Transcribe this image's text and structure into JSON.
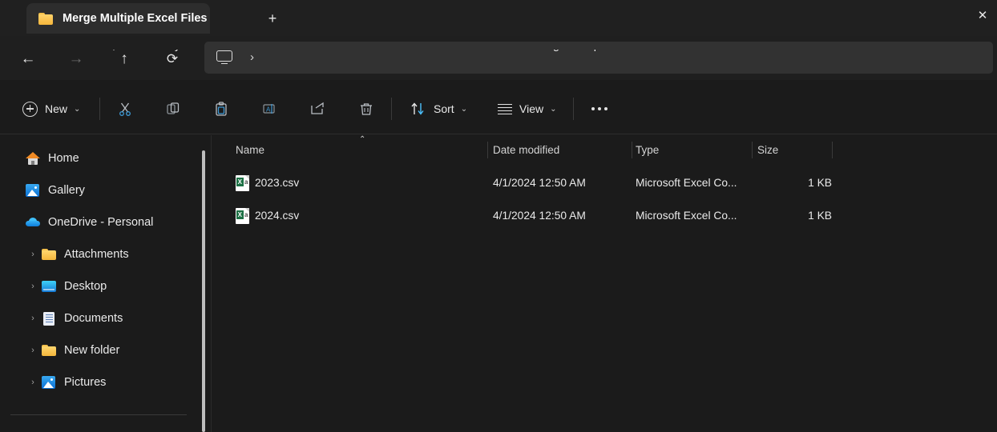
{
  "window": {
    "tab": {
      "title": "Merge Multiple Excel Files",
      "folder_icon": "folder-icon",
      "close_label": "✕"
    },
    "new_tab_label": "+"
  },
  "navigation": {
    "back": "←",
    "forward": "→",
    "up": "↑",
    "refresh": "⟳"
  },
  "address_bar": {
    "monitor_icon": "this-pc-icon",
    "separator": "›",
    "crumb_fragment_1": ",",
    "crumb_fragment_2": "y",
    "crumb_text": "Merge Multiple Excel Files"
  },
  "toolbar": {
    "new_label": "New",
    "cut_label": "Cut",
    "copy_label": "Copy",
    "paste_label": "Paste",
    "rename_label": "Rename",
    "share_label": "Share",
    "delete_label": "Delete",
    "sort_label": "Sort",
    "view_label": "View",
    "more_label": "See more",
    "chevron": "⌄"
  },
  "sidebar": {
    "items": [
      {
        "label": "Home",
        "icon": "home-icon",
        "indent": 0,
        "expander": ""
      },
      {
        "label": "Gallery",
        "icon": "gallery-icon",
        "indent": 0,
        "expander": ""
      },
      {
        "label": "OneDrive - Personal",
        "icon": "onedrive-icon",
        "indent": 0,
        "expander": "⌄"
      },
      {
        "label": "Attachments",
        "icon": "folder-icon",
        "indent": 1,
        "expander": "›"
      },
      {
        "label": "Desktop",
        "icon": "desktop-icon",
        "indent": 1,
        "expander": "›"
      },
      {
        "label": "Documents",
        "icon": "documents-icon",
        "indent": 1,
        "expander": "›"
      },
      {
        "label": "New folder",
        "icon": "folder-icon",
        "indent": 1,
        "expander": "›"
      },
      {
        "label": "Pictures",
        "icon": "pictures-icon",
        "indent": 1,
        "expander": "›"
      }
    ]
  },
  "file_list": {
    "columns": [
      "Name",
      "Date modified",
      "Type",
      "Size"
    ],
    "sort_indicator": "⌃",
    "rows": [
      {
        "name": "2023.csv",
        "date": "4/1/2024 12:50 AM",
        "type": "Microsoft Excel Co...",
        "size": "1 KB",
        "icon": "csv-file-icon"
      },
      {
        "name": "2024.csv",
        "date": "4/1/2024 12:50 AM",
        "type": "Microsoft Excel Co...",
        "size": "1 KB",
        "icon": "csv-file-icon"
      }
    ]
  },
  "colors": {
    "accent_blue": "#4cc2ff",
    "excel_green": "#1d7145",
    "folder_yellow": "#f4b63b",
    "window_bg": "#1b1b1b",
    "titlebar_bg": "#202020"
  }
}
